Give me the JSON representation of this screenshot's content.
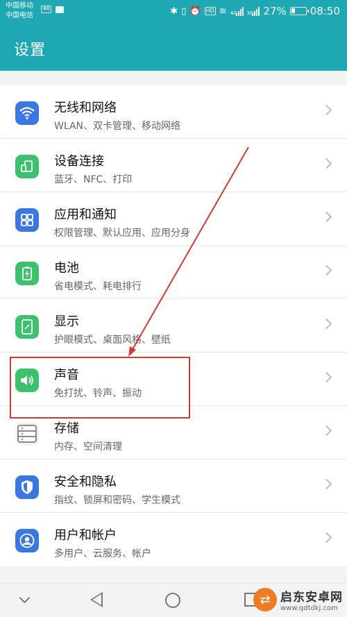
{
  "status_bar": {
    "carrier_1": "中国移动",
    "carrier_2": "中国电信",
    "sim_badge": "满载",
    "network_tag_1": "4G",
    "network_tag_2": "3G",
    "battery_percent": "27%",
    "battery_level": 0.27,
    "time": "08:50",
    "hd_badge": "HD"
  },
  "header": {
    "title": "设置",
    "color": "#1ea8b3"
  },
  "settings_items": [
    {
      "title": "无线和网络",
      "subtitle": "WLAN、双卡管理、移动网络",
      "icon": "wifi-icon"
    },
    {
      "title": "设备连接",
      "subtitle": "蓝牙、NFC、打印",
      "icon": "device-connection-icon"
    },
    {
      "title": "应用和通知",
      "subtitle": "权限管理、默认应用、应用分身",
      "icon": "apps-grid-icon"
    },
    {
      "title": "电池",
      "subtitle": "省电模式、耗电排行",
      "icon": "battery-icon"
    },
    {
      "title": "显示",
      "subtitle": "护眼模式、桌面风格、壁纸",
      "icon": "display-icon"
    },
    {
      "title": "声音",
      "subtitle": "免打扰、铃声、振动",
      "icon": "speaker-icon"
    },
    {
      "title": "存储",
      "subtitle": "内存、空间清理",
      "icon": "storage-icon"
    },
    {
      "title": "安全和隐私",
      "subtitle": "指纹、锁屏和密码、学生模式",
      "icon": "shield-icon"
    },
    {
      "title": "用户和帐户",
      "subtitle": "多用户、云服务、帐户",
      "icon": "user-icon"
    }
  ],
  "annotation": {
    "highlight_color": "#d9372f",
    "highlighted_item": "声音"
  },
  "watermark": {
    "name": "启东安卓网",
    "url": "www.qdtdkj.com"
  }
}
